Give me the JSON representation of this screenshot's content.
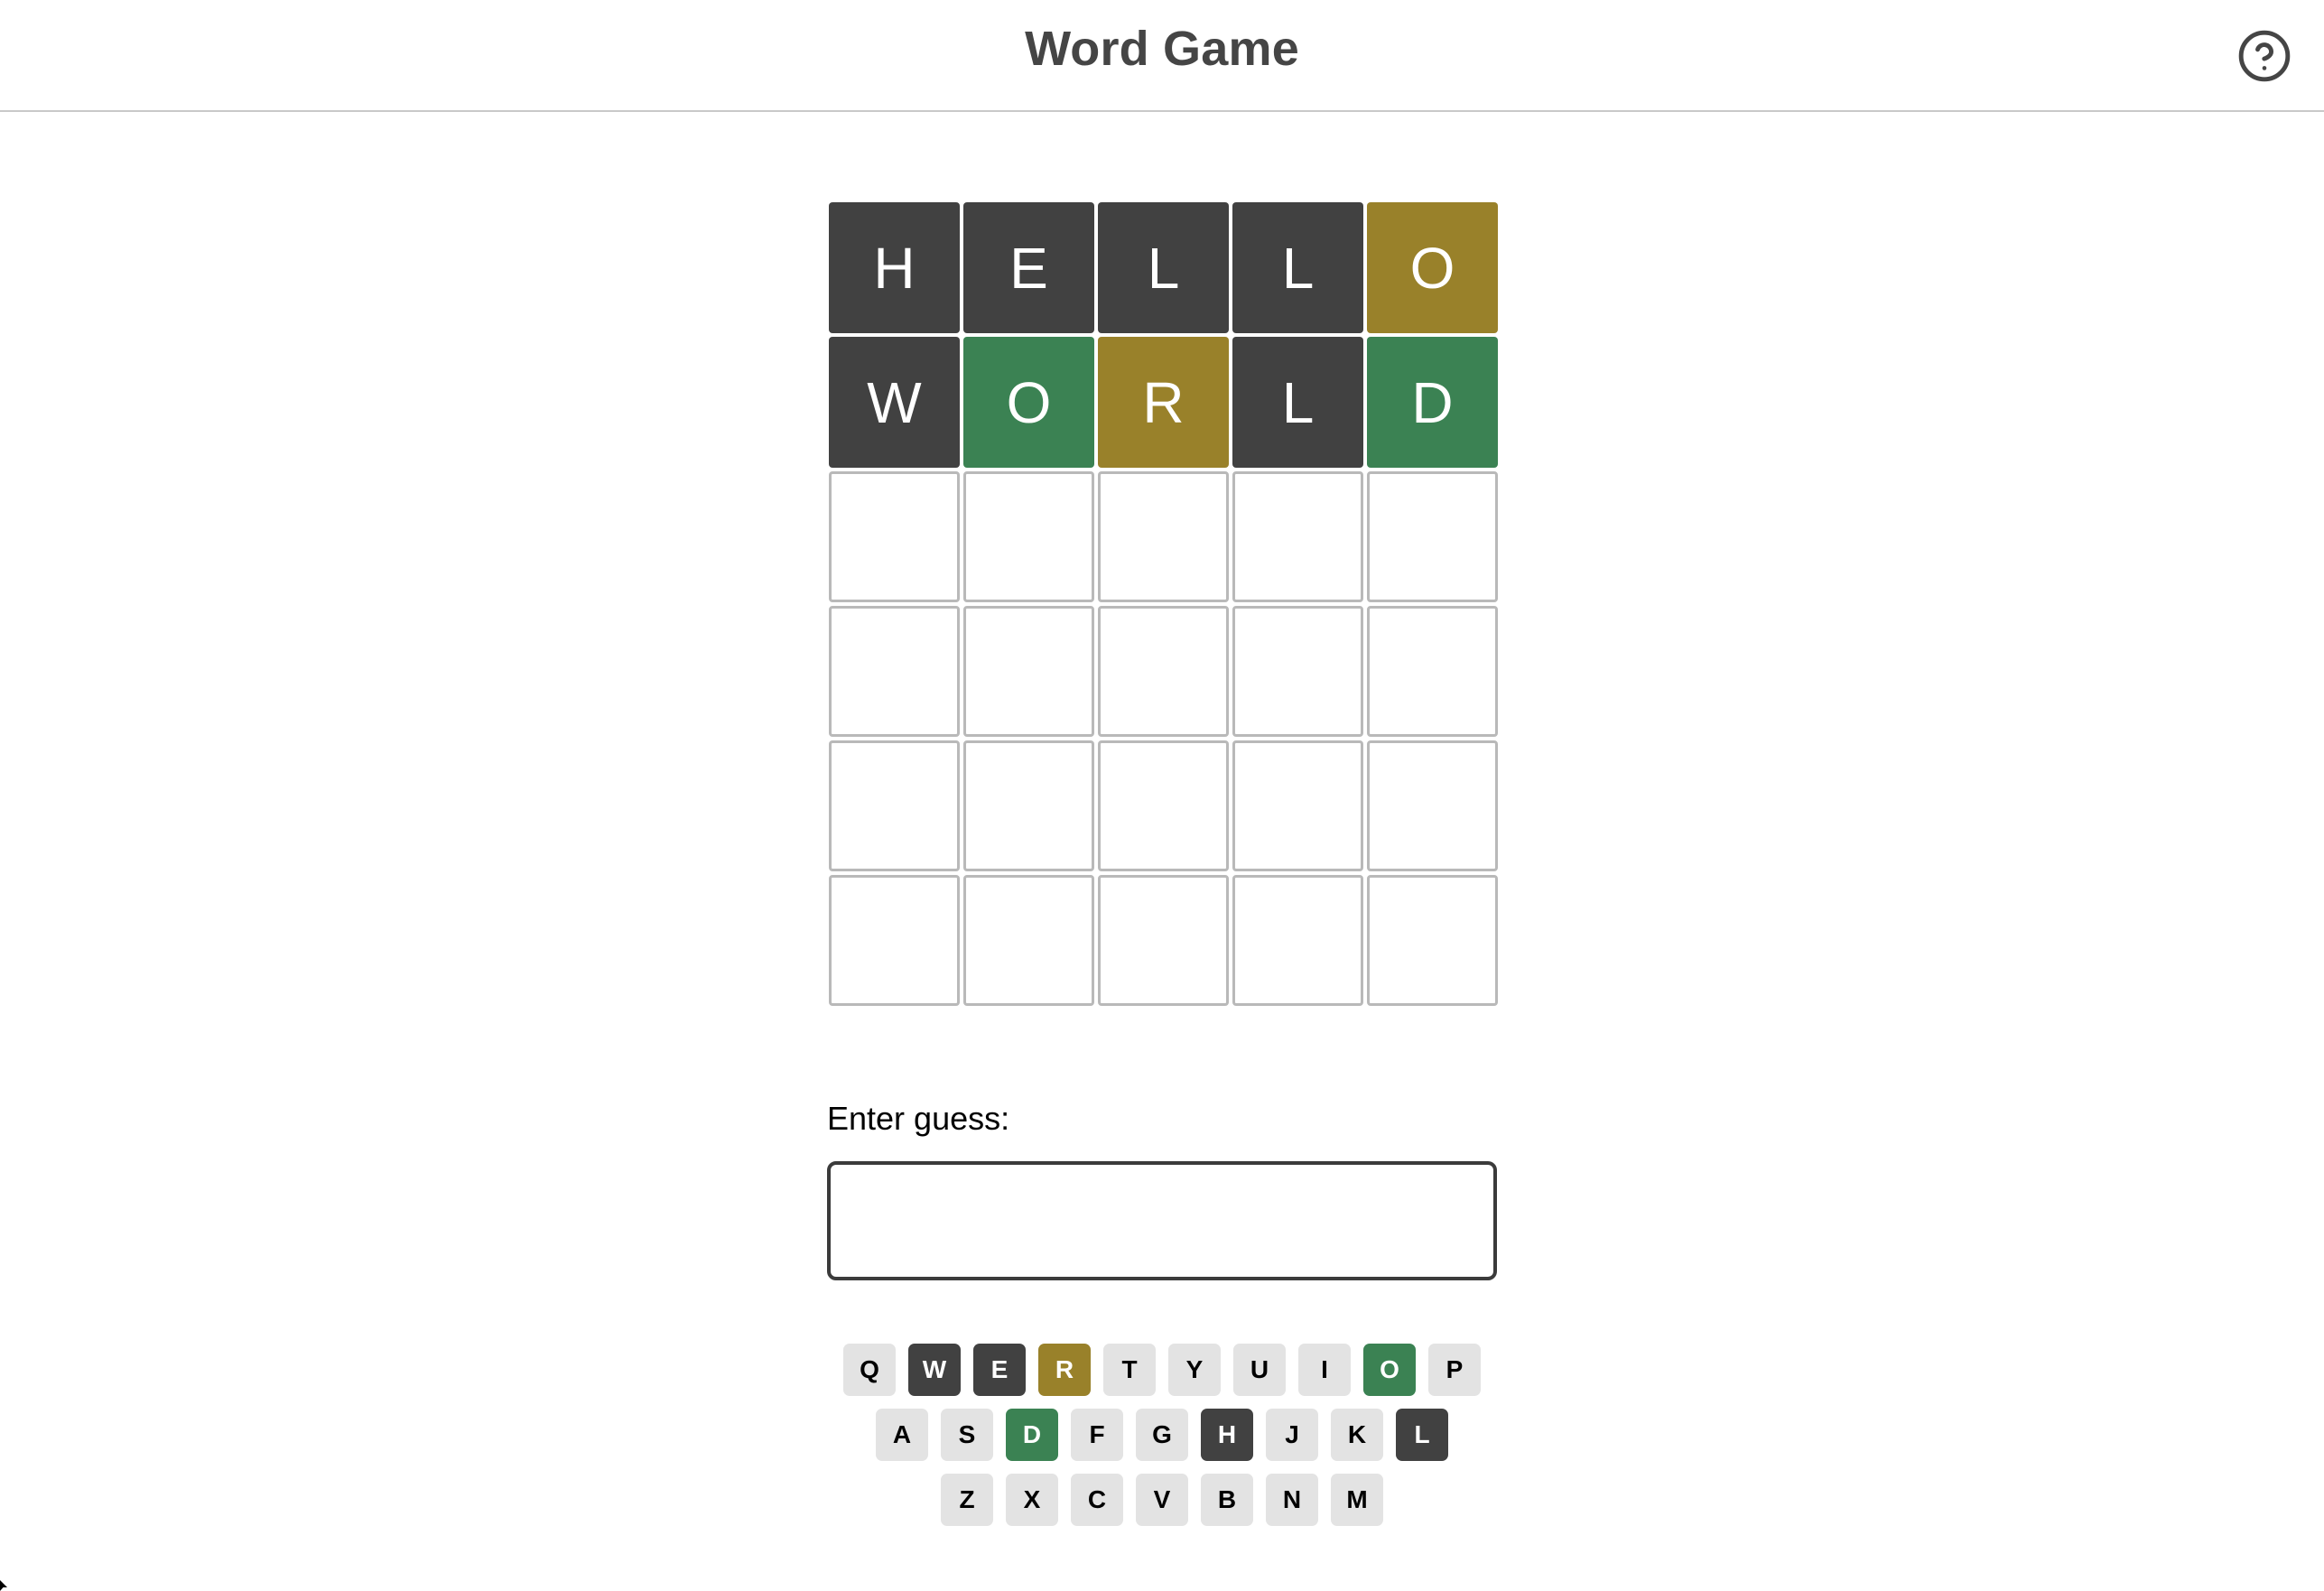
{
  "header": {
    "title": "Word Game",
    "help_icon": "help-circle-icon"
  },
  "board": {
    "rows": 6,
    "columns": 5,
    "guesses": [
      {
        "word": "HELLO",
        "tiles": [
          {
            "letter": "H",
            "state": "absent"
          },
          {
            "letter": "E",
            "state": "absent"
          },
          {
            "letter": "L",
            "state": "absent"
          },
          {
            "letter": "L",
            "state": "absent"
          },
          {
            "letter": "O",
            "state": "present"
          }
        ]
      },
      {
        "word": "WORLD",
        "tiles": [
          {
            "letter": "W",
            "state": "absent"
          },
          {
            "letter": "O",
            "state": "correct"
          },
          {
            "letter": "R",
            "state": "present"
          },
          {
            "letter": "L",
            "state": "absent"
          },
          {
            "letter": "D",
            "state": "correct"
          }
        ]
      },
      {
        "word": "",
        "tiles": [
          {
            "letter": "",
            "state": "empty"
          },
          {
            "letter": "",
            "state": "empty"
          },
          {
            "letter": "",
            "state": "empty"
          },
          {
            "letter": "",
            "state": "empty"
          },
          {
            "letter": "",
            "state": "empty"
          }
        ]
      },
      {
        "word": "",
        "tiles": [
          {
            "letter": "",
            "state": "empty"
          },
          {
            "letter": "",
            "state": "empty"
          },
          {
            "letter": "",
            "state": "empty"
          },
          {
            "letter": "",
            "state": "empty"
          },
          {
            "letter": "",
            "state": "empty"
          }
        ]
      },
      {
        "word": "",
        "tiles": [
          {
            "letter": "",
            "state": "empty"
          },
          {
            "letter": "",
            "state": "empty"
          },
          {
            "letter": "",
            "state": "empty"
          },
          {
            "letter": "",
            "state": "empty"
          },
          {
            "letter": "",
            "state": "empty"
          }
        ]
      },
      {
        "word": "",
        "tiles": [
          {
            "letter": "",
            "state": "empty"
          },
          {
            "letter": "",
            "state": "empty"
          },
          {
            "letter": "",
            "state": "empty"
          },
          {
            "letter": "",
            "state": "empty"
          },
          {
            "letter": "",
            "state": "empty"
          }
        ]
      }
    ]
  },
  "guess": {
    "label": "Enter guess:",
    "value": "",
    "placeholder": ""
  },
  "keyboard": {
    "rows": [
      [
        {
          "key": "Q",
          "state": "default"
        },
        {
          "key": "W",
          "state": "absent"
        },
        {
          "key": "E",
          "state": "absent"
        },
        {
          "key": "R",
          "state": "present"
        },
        {
          "key": "T",
          "state": "default"
        },
        {
          "key": "Y",
          "state": "default"
        },
        {
          "key": "U",
          "state": "default"
        },
        {
          "key": "I",
          "state": "default"
        },
        {
          "key": "O",
          "state": "correct"
        },
        {
          "key": "P",
          "state": "default"
        }
      ],
      [
        {
          "key": "A",
          "state": "default"
        },
        {
          "key": "S",
          "state": "default"
        },
        {
          "key": "D",
          "state": "correct"
        },
        {
          "key": "F",
          "state": "default"
        },
        {
          "key": "G",
          "state": "default"
        },
        {
          "key": "H",
          "state": "absent"
        },
        {
          "key": "J",
          "state": "default"
        },
        {
          "key": "K",
          "state": "default"
        },
        {
          "key": "L",
          "state": "absent"
        }
      ],
      [
        {
          "key": "Z",
          "state": "default"
        },
        {
          "key": "X",
          "state": "default"
        },
        {
          "key": "C",
          "state": "default"
        },
        {
          "key": "V",
          "state": "default"
        },
        {
          "key": "B",
          "state": "default"
        },
        {
          "key": "N",
          "state": "default"
        },
        {
          "key": "M",
          "state": "default"
        }
      ]
    ]
  },
  "colors": {
    "absent": "#414141",
    "present": "#99812a",
    "correct": "#3b8253",
    "key_default": "#e3e3e3",
    "tile_empty_border": "#b9b9b9",
    "title": "#454545",
    "header_divider": "#c9c9c9",
    "input_border": "#3b3b3b"
  }
}
